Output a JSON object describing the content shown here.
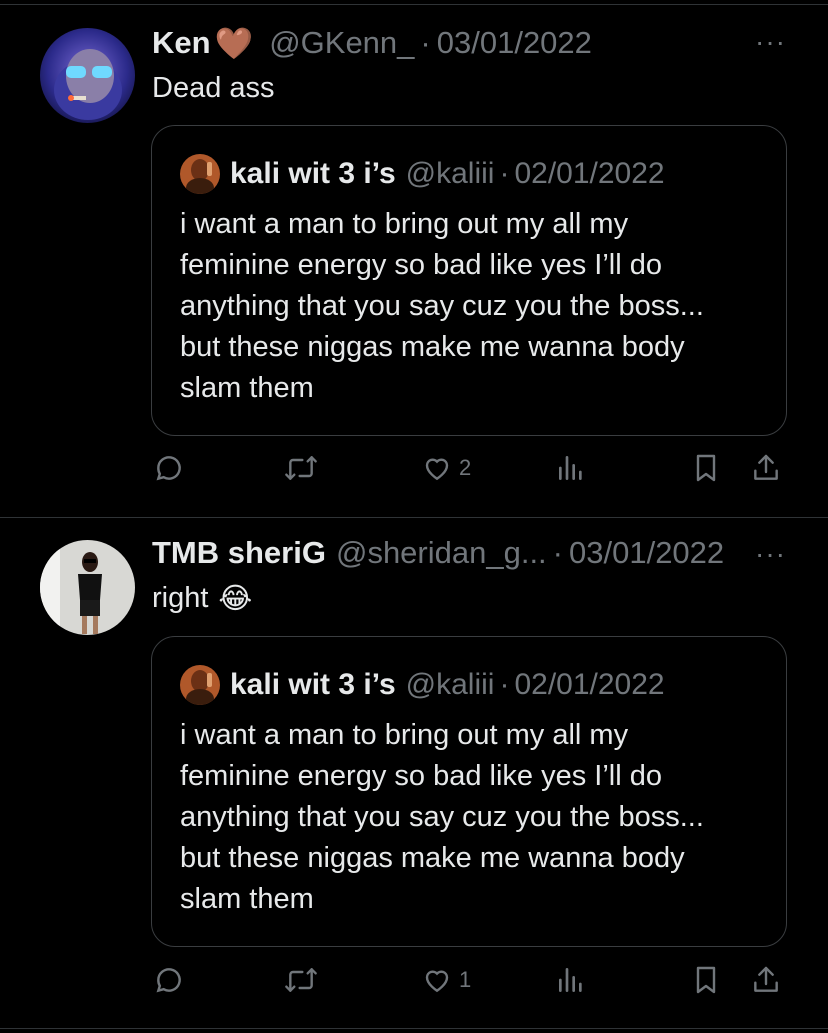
{
  "tweets": [
    {
      "name": "Ken",
      "name_emoji": "🤎",
      "handle": "@GKenn_",
      "date": "03/01/2022",
      "more": "···",
      "text": "Dead ass",
      "text_emoji": "",
      "quote": {
        "name": "kali wit 3 i’s",
        "handle": "@kaliii",
        "date": "02/01/2022",
        "lines": [
          "i want a man to bring out my all my",
          "feminine energy so bad like yes I’ll do",
          "anything that you say cuz you the boss...",
          "but these niggas make me wanna body",
          "slam them"
        ]
      },
      "actions": {
        "reply": "",
        "retweet": "",
        "like": "2",
        "views": ""
      }
    },
    {
      "name": "TMB sheriG",
      "name_emoji": "",
      "handle": "@sheridan_g...",
      "date": "03/01/2022",
      "more": "···",
      "text": "right",
      "text_emoji": "😂",
      "quote": {
        "name": "kali wit 3 i’s",
        "handle": "@kaliii",
        "date": "02/01/2022",
        "lines": [
          "i want a man to bring out my all my",
          "feminine energy so bad like yes I’ll do",
          "anything that you say cuz you the boss...",
          "but these niggas make me wanna body",
          "slam them"
        ]
      },
      "actions": {
        "reply": "",
        "retweet": "",
        "like": "1",
        "views": ""
      }
    }
  ],
  "colors": {
    "background": "#000000",
    "text": "#e7e9ea",
    "muted": "#71767b",
    "border": "#2f3336"
  },
  "icons": [
    "reply-icon",
    "retweet-icon",
    "like-icon",
    "views-icon",
    "bookmark-icon",
    "share-icon",
    "more-icon"
  ]
}
